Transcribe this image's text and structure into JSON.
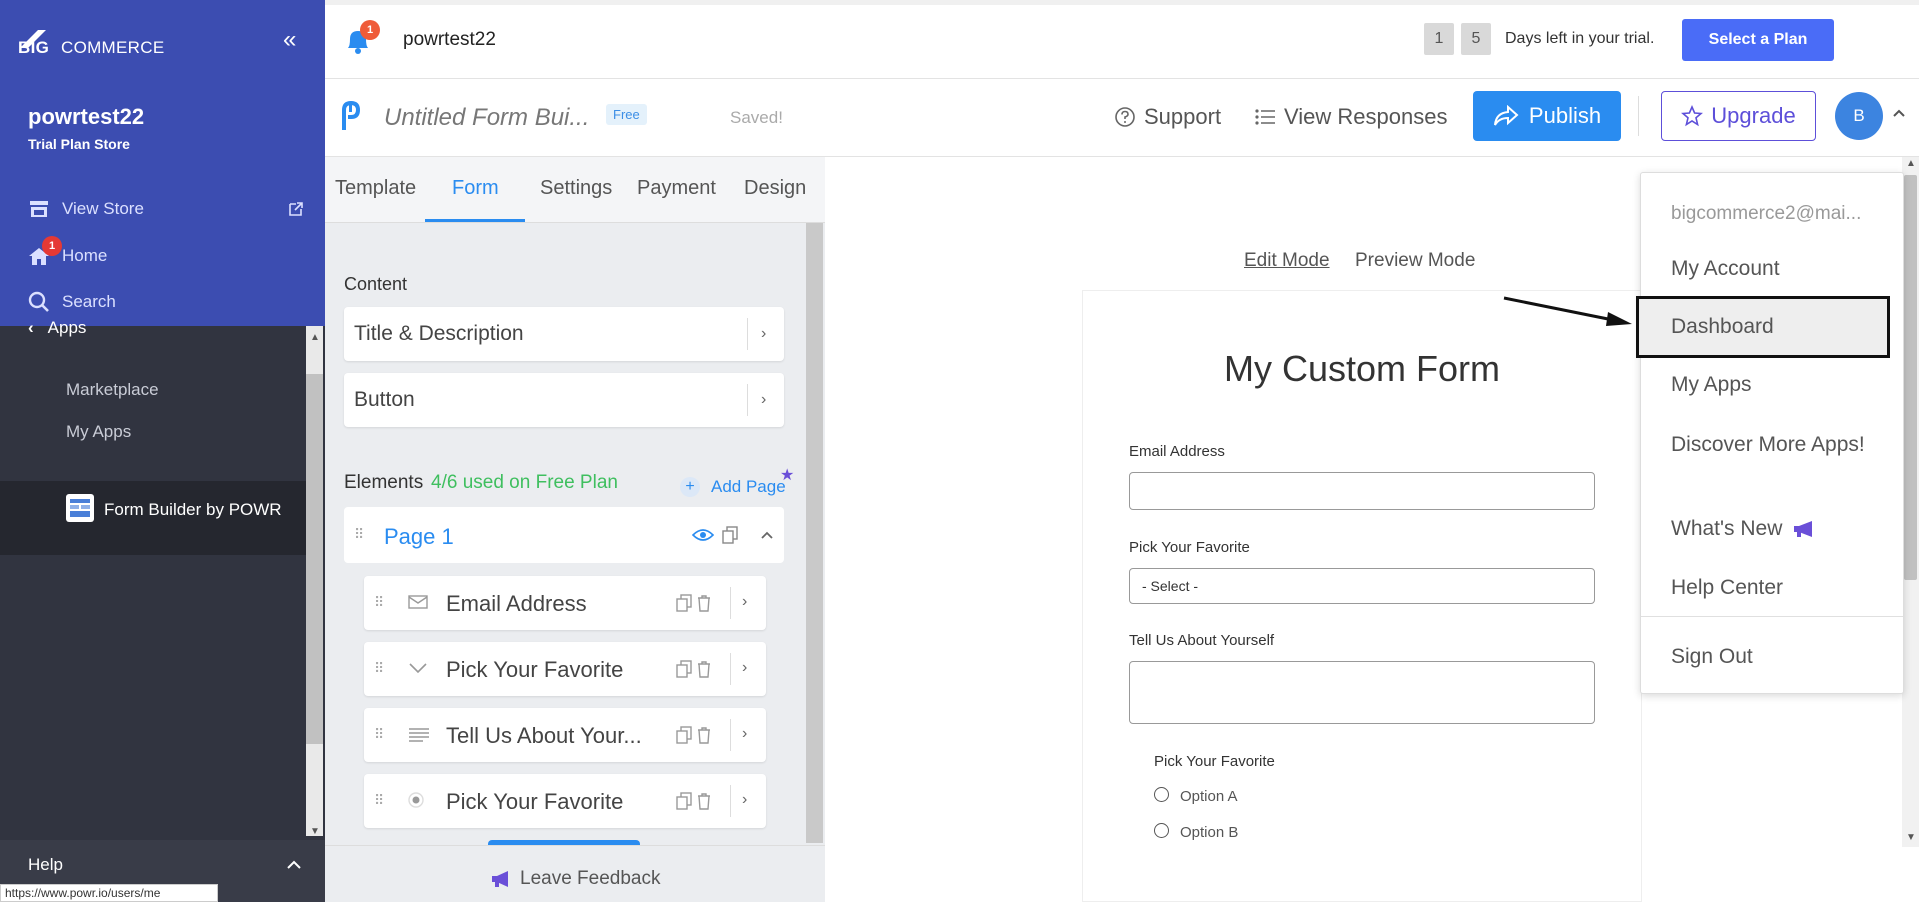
{
  "sidebar": {
    "logo_big": "BIG",
    "logo_rest": "COMMERCE",
    "store_name": "powrtest22",
    "store_plan": "Trial Plan Store",
    "nav": {
      "view_store": "View Store",
      "home": "Home",
      "home_badge": "1",
      "search": "Search",
      "apps": "Apps"
    },
    "apps_sub": {
      "marketplace": "Marketplace",
      "my_apps": "My Apps"
    },
    "active_app": "Form Builder by POWR",
    "help": "Help",
    "status_url": "https://www.powr.io/users/me"
  },
  "topbar": {
    "notif_count": "1",
    "store": "powrtest22",
    "days": [
      "1",
      "5"
    ],
    "trial_text": "Days left in your trial.",
    "select_plan": "Select a Plan"
  },
  "header": {
    "form_title": "Untitled Form Bui...",
    "free_tag": "Free",
    "saved": "Saved!",
    "support": "Support",
    "view_responses": "View Responses",
    "publish": "Publish",
    "upgrade": "Upgrade",
    "avatar": "B"
  },
  "editor": {
    "tabs": [
      "Template",
      "Form",
      "Settings",
      "Payment",
      "Design"
    ],
    "content_label": "Content",
    "content_cards": [
      "Title & Description",
      "Button"
    ],
    "elements_label": "Elements",
    "elements_count": "4/6 used on Free Plan",
    "add_page": "Add Page",
    "page": "Page 1",
    "elements": [
      "Email Address",
      "Pick Your Favorite",
      "Tell Us About Your...",
      "Pick Your Favorite"
    ],
    "leave_feedback": "Leave Feedback"
  },
  "preview": {
    "mode_edit": "Edit Mode",
    "mode_preview": "Preview Mode",
    "form_heading": "My Custom Form",
    "email_label": "Email Address",
    "favorite_label": "Pick Your Favorite",
    "select_placeholder": "- Select -",
    "tell_label": "Tell Us About Yourself",
    "radio_label": "Pick Your Favorite",
    "radio_options": [
      "Option A",
      "Option B"
    ]
  },
  "dropdown": {
    "email": "bigcommerce2@mai...",
    "my_account": "My Account",
    "dashboard": "Dashboard",
    "my_apps": "My Apps",
    "discover": "Discover More Apps!",
    "whats_new": "What's New",
    "help_center": "Help Center",
    "sign_out": "Sign Out"
  }
}
